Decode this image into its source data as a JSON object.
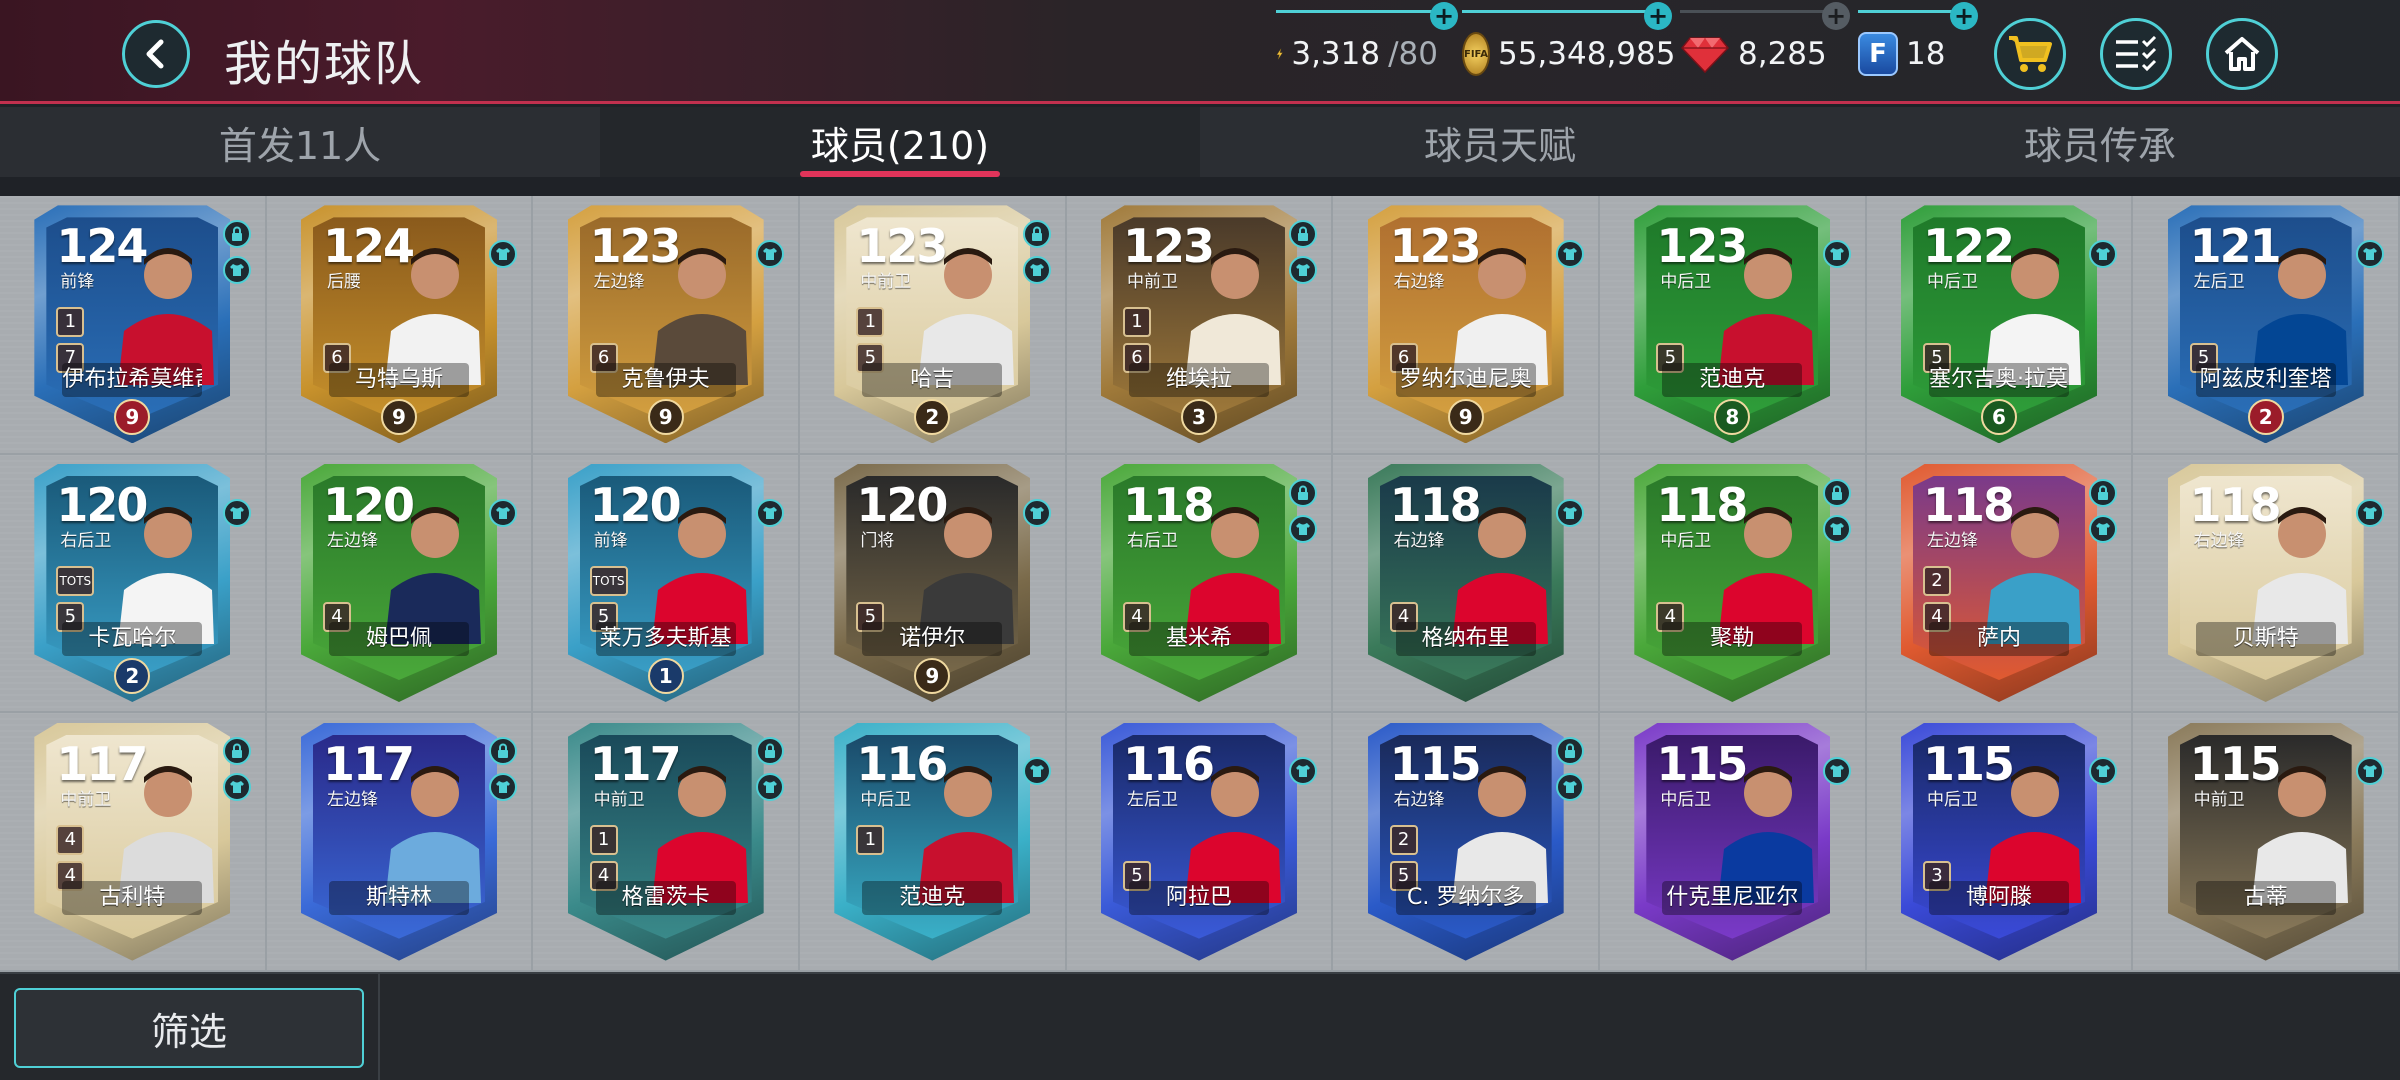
{
  "header": {
    "title": "我的球队",
    "energy": {
      "value": "3,318",
      "max": "/80"
    },
    "coins": "55,348,985",
    "gems": "8,285",
    "fifa_points": "18",
    "coin_icon_text": "FIFA"
  },
  "tabs": [
    {
      "label": "首发11人",
      "active": false
    },
    {
      "label": "球员(210)",
      "active": true
    },
    {
      "label": "球员天赋",
      "active": false
    },
    {
      "label": "球员传承",
      "active": false
    }
  ],
  "players": [
    {
      "ovr": "124",
      "pos": "前锋",
      "name": "伊布拉希莫维奇",
      "rank": "9",
      "lvl1": "1",
      "lvl2": "7",
      "frame": "#2a6fb8",
      "inner": "#1d4e8c",
      "rankColor": "#9b1c2a",
      "kit": "#c8102e",
      "locked": true
    },
    {
      "ovr": "124",
      "pos": "后腰",
      "name": "马特乌斯",
      "rank": "9",
      "lvl1": "",
      "lvl2": "6",
      "frame": "#c8922c",
      "inner": "#8a5a1c",
      "rankColor": "#3a2a18",
      "kit": "#f2f2f2",
      "locked": false
    },
    {
      "ovr": "123",
      "pos": "左边锋",
      "name": "克鲁伊夫",
      "rank": "9",
      "lvl1": "",
      "lvl2": "6",
      "frame": "#d4a040",
      "inner": "#9a6a2a",
      "rankColor": "#3a2a18",
      "kit": "#5a4a3a",
      "locked": false
    },
    {
      "ovr": "123",
      "pos": "中前卫",
      "name": "哈吉",
      "rank": "2",
      "lvl1": "1",
      "lvl2": "5",
      "frame": "#d8c89a",
      "inner": "#efe6cf",
      "rankColor": "#3a2a18",
      "kit": "#e8e8e8",
      "locked": true
    },
    {
      "ovr": "123",
      "pos": "中前卫",
      "name": "维埃拉",
      "rank": "3",
      "lvl1": "1",
      "lvl2": "6",
      "frame": "#a07a3a",
      "inner": "#4a3a2a",
      "rankColor": "#3a2a18",
      "kit": "#f0e8d8",
      "locked": true
    },
    {
      "ovr": "123",
      "pos": "右边锋",
      "name": "罗纳尔迪尼奥",
      "rank": "9",
      "lvl1": "",
      "lvl2": "6",
      "frame": "#d4a040",
      "inner": "#b07030",
      "rankColor": "#3a2a18",
      "kit": "#f0f0f0",
      "locked": false
    },
    {
      "ovr": "123",
      "pos": "中后卫",
      "name": "范迪克",
      "rank": "8",
      "lvl1": "",
      "lvl2": "5",
      "frame": "#2f9e3a",
      "inner": "#1f7a2a",
      "rankColor": "#1a5a20",
      "kit": "#c8102e",
      "locked": false
    },
    {
      "ovr": "122",
      "pos": "中后卫",
      "name": "塞尔吉奥·拉莫斯",
      "rank": "6",
      "lvl1": "",
      "lvl2": "5",
      "frame": "#2f9e3a",
      "inner": "#1f7a2a",
      "rankColor": "#1a5a20",
      "kit": "#f4f4f4",
      "locked": false
    },
    {
      "ovr": "121",
      "pos": "左后卫",
      "name": "阿兹皮利奎塔",
      "rank": "2",
      "lvl1": "",
      "lvl2": "5",
      "frame": "#2a6fb8",
      "inner": "#1d4e8c",
      "rankColor": "#9b1c2a",
      "kit": "#034694",
      "locked": false
    },
    {
      "ovr": "120",
      "pos": "右后卫",
      "name": "卡瓦哈尔",
      "rank": "2",
      "lvl1": "TOTS",
      "lvl2": "5",
      "frame": "#3aa0c8",
      "inner": "#1a5a7a",
      "rankColor": "#1a3a6a",
      "kit": "#f4f4f4",
      "locked": false
    },
    {
      "ovr": "120",
      "pos": "左边锋",
      "name": "姆巴佩",
      "rank": "",
      "lvl1": "",
      "lvl2": "4",
      "frame": "#4aa83a",
      "inner": "#2a7a2a",
      "rankColor": "#2a7a2a",
      "kit": "#1a2a5a",
      "locked": false
    },
    {
      "ovr": "120",
      "pos": "前锋",
      "name": "莱万多夫斯基",
      "rank": "1",
      "lvl1": "TOTS",
      "lvl2": "5",
      "frame": "#3aa0c8",
      "inner": "#1a5a7a",
      "rankColor": "#1a3a6a",
      "kit": "#dc052d",
      "locked": false
    },
    {
      "ovr": "120",
      "pos": "门将",
      "name": "诺伊尔",
      "rank": "9",
      "lvl1": "",
      "lvl2": "5",
      "frame": "#7a6a4a",
      "inner": "#2a2a2a",
      "rankColor": "#3a2a18",
      "kit": "#3a3a3a",
      "locked": false
    },
    {
      "ovr": "118",
      "pos": "右后卫",
      "name": "基米希",
      "rank": "",
      "lvl1": "",
      "lvl2": "4",
      "frame": "#4aa83a",
      "inner": "#2a7a2a",
      "rankColor": "#2a7a2a",
      "kit": "#dc052d",
      "locked": true
    },
    {
      "ovr": "118",
      "pos": "右边锋",
      "name": "格纳布里",
      "rank": "",
      "lvl1": "",
      "lvl2": "4",
      "frame": "#3a7a5a",
      "inner": "#1a3a4a",
      "rankColor": "#2a2a2a",
      "kit": "#dc052d",
      "locked": false
    },
    {
      "ovr": "118",
      "pos": "中后卫",
      "name": "聚勒",
      "rank": "",
      "lvl1": "",
      "lvl2": "4",
      "frame": "#4aa83a",
      "inner": "#2a7a2a",
      "rankColor": "#2a7a2a",
      "kit": "#dc052d",
      "locked": true
    },
    {
      "ovr": "118",
      "pos": "左边锋",
      "name": "萨内",
      "rank": "",
      "lvl1": "2",
      "lvl2": "4",
      "frame": "#e05a30",
      "inner": "#7a3a8a",
      "rankColor": "#2a2a2a",
      "kit": "#3aa0c8",
      "locked": true
    },
    {
      "ovr": "118",
      "pos": "右边锋",
      "name": "贝斯特",
      "rank": "",
      "lvl1": "",
      "lvl2": "",
      "frame": "#d8c89a",
      "inner": "#efe6cf",
      "rankColor": "#3a2a18",
      "kit": "#e8e8e8",
      "locked": false
    },
    {
      "ovr": "117",
      "pos": "中前卫",
      "name": "古利特",
      "rank": "",
      "lvl1": "4",
      "lvl2": "4",
      "frame": "#d8c89a",
      "inner": "#efe6cf",
      "rankColor": "#3a2a18",
      "kit": "#dcdcdc",
      "locked": true
    },
    {
      "ovr": "117",
      "pos": "左边锋",
      "name": "斯特林",
      "rank": "",
      "lvl1": "",
      "lvl2": "",
      "frame": "#3a6ad8",
      "inner": "#2a2a8a",
      "rankColor": "#6a2a9a",
      "kit": "#6cabdd",
      "locked": true
    },
    {
      "ovr": "117",
      "pos": "中前卫",
      "name": "格雷茨卡",
      "rank": "",
      "lvl1": "1",
      "lvl2": "4",
      "frame": "#3a8a8a",
      "inner": "#1a4a5a",
      "rankColor": "#2a2a2a",
      "kit": "#dc052d",
      "locked": true
    },
    {
      "ovr": "116",
      "pos": "中后卫",
      "name": "范迪克",
      "rank": "",
      "lvl1": "1",
      "lvl2": "",
      "frame": "#3ab0c8",
      "inner": "#1a4a6a",
      "rankColor": "#5a2a9a",
      "kit": "#c8102e",
      "locked": false
    },
    {
      "ovr": "116",
      "pos": "左后卫",
      "name": "阿拉巴",
      "rank": "",
      "lvl1": "",
      "lvl2": "5",
      "frame": "#3a5ad8",
      "inner": "#1a2a6a",
      "rankColor": "#6a2a9a",
      "kit": "#dc052d",
      "locked": false
    },
    {
      "ovr": "115",
      "pos": "右边锋",
      "name": "C. 罗纳尔多",
      "rank": "",
      "lvl1": "2",
      "lvl2": "5",
      "frame": "#2a5ac8",
      "inner": "#1a2a5a",
      "rankColor": "#6a2a9a",
      "kit": "#e8e8e8",
      "locked": true
    },
    {
      "ovr": "115",
      "pos": "中后卫",
      "name": "什克里尼亚尔",
      "rank": "",
      "lvl1": "",
      "lvl2": "",
      "frame": "#7a3ac8",
      "inner": "#3a1a6a",
      "rankColor": "#2a2a2a",
      "kit": "#0a3aa0",
      "locked": false
    },
    {
      "ovr": "115",
      "pos": "中后卫",
      "name": "博阿滕",
      "rank": "",
      "lvl1": "",
      "lvl2": "3",
      "frame": "#3a4ad8",
      "inner": "#1a2a6a",
      "rankColor": "#6a2a9a",
      "kit": "#dc052d",
      "locked": false
    },
    {
      "ovr": "115",
      "pos": "中前卫",
      "name": "古蒂",
      "rank": "",
      "lvl1": "",
      "lvl2": "",
      "frame": "#8a7a5a",
      "inner": "#2a2a2a",
      "rankColor": "#3a2a18",
      "kit": "#e8e8e8",
      "locked": false
    }
  ],
  "bottom": {
    "filter_label": "筛选"
  },
  "colors": {
    "accent": "#4fd0d6",
    "tab_indicator": "#e0345a",
    "header_border": "#c2304e"
  }
}
